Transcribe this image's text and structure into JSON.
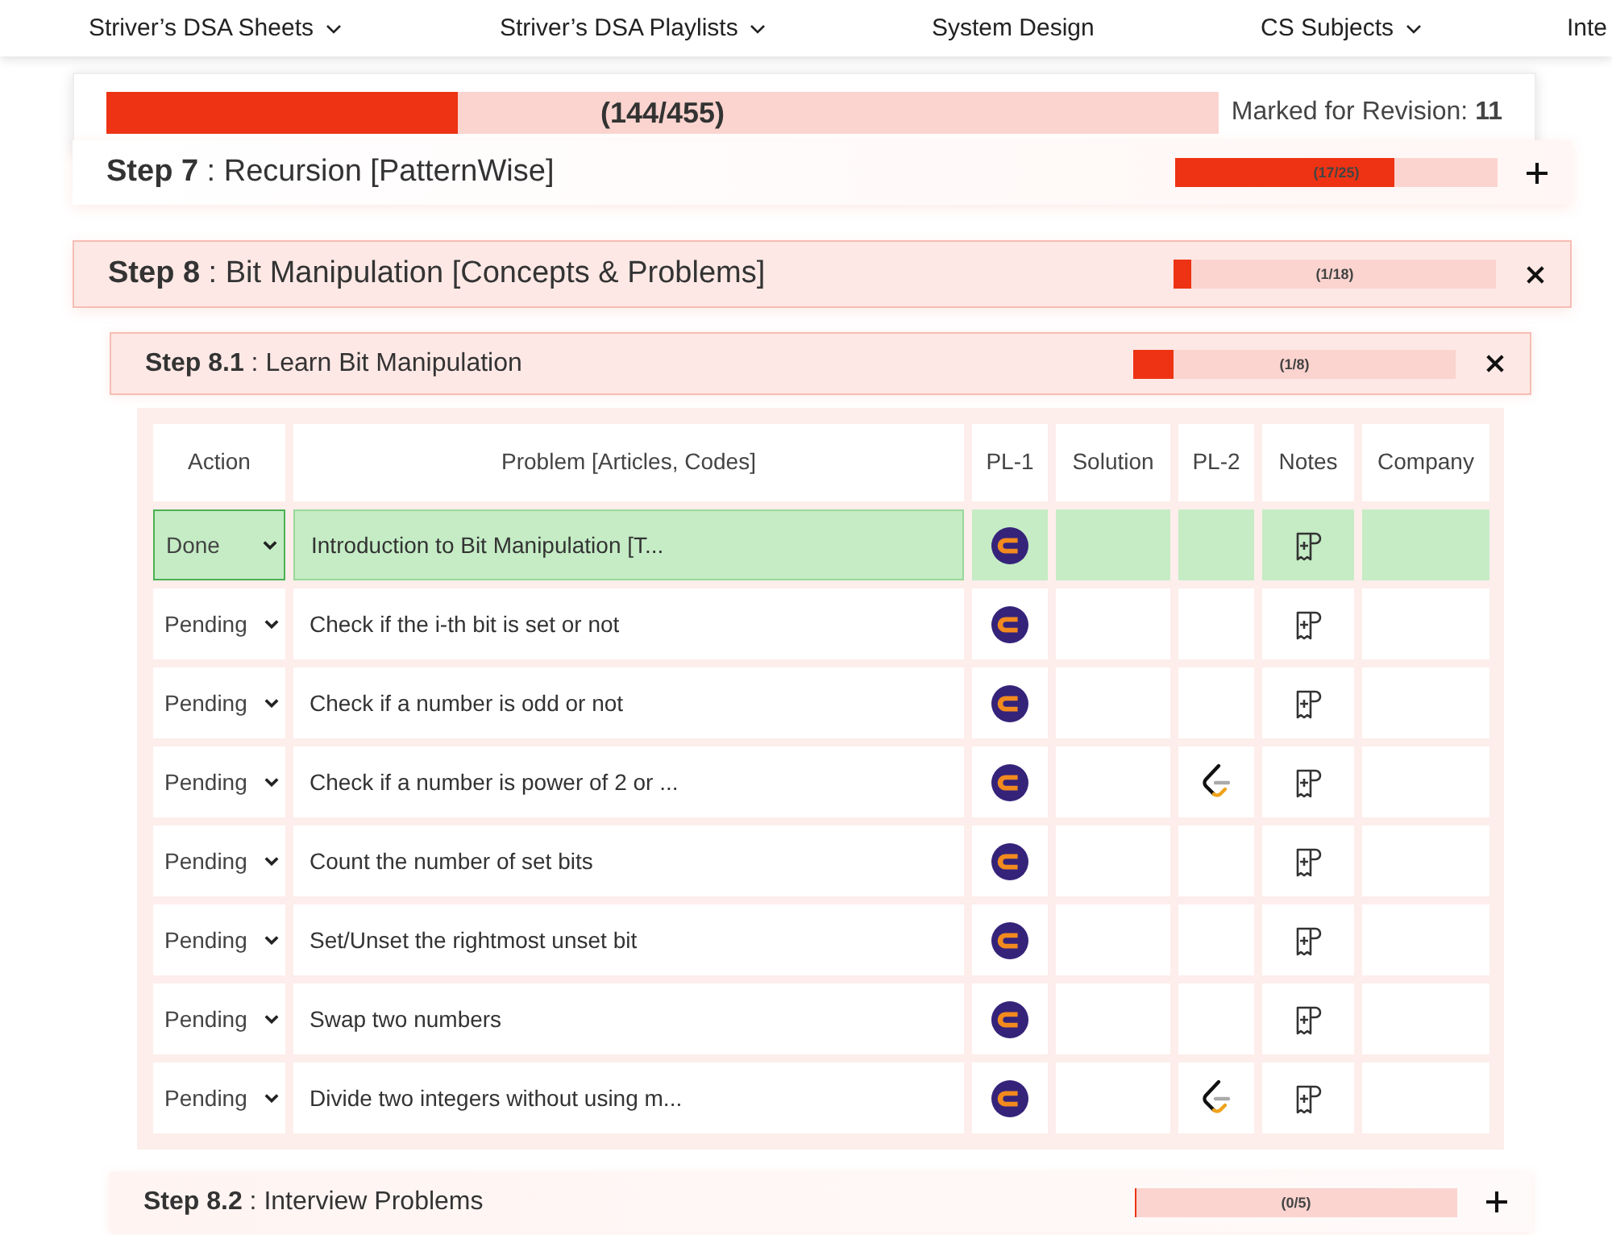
{
  "nav": [
    {
      "label": "Striver’s DSA Sheets",
      "dropdown": true
    },
    {
      "label": "Striver’s DSA Playlists",
      "dropdown": true
    },
    {
      "label": "System Design",
      "dropdown": false
    },
    {
      "label": "CS Subjects",
      "dropdown": true
    },
    {
      "label": "Inte",
      "dropdown": false
    }
  ],
  "progress": {
    "level": 0.3165,
    "count": "(144/455)",
    "revision_label": "Marked for Revision:",
    "revision_count": "11"
  },
  "steps": [
    {
      "title": "**Step 7** : Recursion [PatternWise]",
      "level": 0.68,
      "count": "(17/25)",
      "expanded": false
    },
    {
      "title": "**Step 8** : Bit Manipulation [Concepts & Problems]",
      "level": 0.0556,
      "count": "(1/18)",
      "expanded": true,
      "substeps": [
        {
          "title": "**Step 8.1** : Learn Bit Manipulation",
          "level": 0.125,
          "count": "(1/8)",
          "expanded": true,
          "table": {
            "columns": [
              "Action",
              "Problem [Articles, Codes]",
              "PL-1",
              "Solution",
              "PL-2",
              "Notes",
              "Company"
            ],
            "rows": [
              {
                "status": "Done",
                "done": true,
                "problem": "Introduction to Bit Manipulation [T...",
                "pl1": true,
                "pl2": false
              },
              {
                "status": "Pending",
                "done": false,
                "problem": "Check if the i-th bit is set or not",
                "pl1": true,
                "pl2": false
              },
              {
                "status": "Pending",
                "done": false,
                "problem": "Check if a number is odd or not",
                "pl1": true,
                "pl2": false
              },
              {
                "status": "Pending",
                "done": false,
                "problem": "Check if a number is power of 2 or ...",
                "pl1": true,
                "pl2": true
              },
              {
                "status": "Pending",
                "done": false,
                "problem": "Count the number of set bits",
                "pl1": true,
                "pl2": false
              },
              {
                "status": "Pending",
                "done": false,
                "problem": "Set/Unset the rightmost unset bit",
                "pl1": true,
                "pl2": false
              },
              {
                "status": "Pending",
                "done": false,
                "problem": "Swap two numbers",
                "pl1": true,
                "pl2": false
              },
              {
                "status": "Pending",
                "done": false,
                "problem": "Divide two integers without using m...",
                "pl1": true,
                "pl2": true
              }
            ]
          }
        },
        {
          "title": "**Step 8.2** : Interview Problems",
          "level": 0,
          "count": "(0/5)",
          "expanded": false
        }
      ]
    }
  ]
}
